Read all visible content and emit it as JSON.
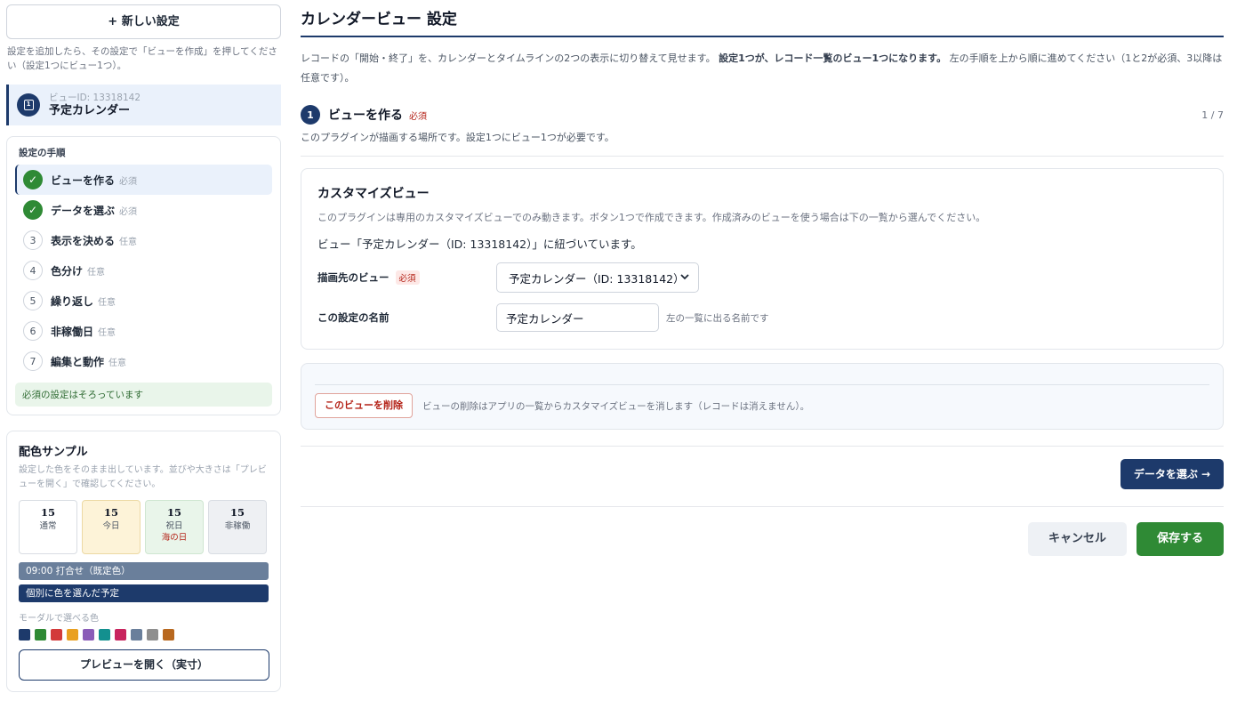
{
  "sidebar": {
    "new_button": "+ 新しい設定",
    "hint": "設定を追加したら、その設定で「ビューを作成」を押してください（設定1つにビュー1つ）。",
    "view": {
      "id_label": "ビューID: 13318142",
      "name": "予定カレンダー",
      "icon": "calendar-icon"
    },
    "steps_title": "設定の手順",
    "steps": [
      {
        "num": "✓",
        "label": "ビューを作る",
        "tag": "必須"
      },
      {
        "num": "✓",
        "label": "データを選ぶ",
        "tag": "必須"
      },
      {
        "num": "3",
        "label": "表示を決める",
        "tag": "任意"
      },
      {
        "num": "4",
        "label": "色分け",
        "tag": "任意"
      },
      {
        "num": "5",
        "label": "繰り返し",
        "tag": "任意"
      },
      {
        "num": "6",
        "label": "非稼働日",
        "tag": "任意"
      },
      {
        "num": "7",
        "label": "編集と動作",
        "tag": "任意"
      }
    ],
    "steps_status": "必須の設定はそろっています"
  },
  "sample": {
    "title": "配色サンプル",
    "hint": "設定した色をそのまま出しています。並びや大きさは「プレビューを開く」で確認してください。",
    "days": [
      {
        "num": "15",
        "label": "通常",
        "sub": ""
      },
      {
        "num": "15",
        "label": "今日",
        "sub": ""
      },
      {
        "num": "15",
        "label": "祝日",
        "sub": "海の日"
      },
      {
        "num": "15",
        "label": "非稼働",
        "sub": ""
      }
    ],
    "event_default": "09:00 打合せ（既定色）",
    "event_custom": "個別に色を選んだ予定",
    "palette_label": "モーダルで選べる色",
    "palette": [
      "#1d3a6b",
      "#2f8a35",
      "#d33a3a",
      "#e9a020",
      "#8a5cb8",
      "#13908f",
      "#c8245e",
      "#6a7f9b",
      "#8e8e8e",
      "#b8681f"
    ],
    "preview_button": "プレビューを開く（実寸）"
  },
  "main": {
    "title": "カレンダービュー 設定",
    "intro_1": "レコードの「開始・終了」を、カレンダーとタイムラインの2つの表示に切り替えて見せます。",
    "intro_bold": "設定1つが、レコード一覧のビュー1つになります。",
    "intro_2": "左の手順を上から順に進めてください（1と2が必須、3以降は任意です）。",
    "step": {
      "num": "1",
      "title": "ビューを作る",
      "req": "必須",
      "count": "1 / 7",
      "desc": "このプラグインが描画する場所です。設定1つにビュー1つが必要です。"
    },
    "card": {
      "title": "カスタマイズビュー",
      "desc": "このプラグインは専用のカスタマイズビューでのみ動きます。ボタン1つで作成できます。作成済みのビューを使う場合は下の一覧から選んでください。",
      "link_status": "ビュー「予定カレンダー（ID: 13318142）」に紐づいています。",
      "target_label": "描画先のビュー",
      "target_req": "必須",
      "target_value": "予定カレンダー（ID: 13318142）",
      "name_label": "この設定の名前",
      "name_value": "予定カレンダー",
      "name_hint": "左の一覧に出る名前です"
    },
    "danger": {
      "delete_button": "このビューを削除",
      "hint": "ビューの削除はアプリの一覧からカスタマイズビューを消します（レコードは消えません）。"
    },
    "next_button": "データを選ぶ →",
    "cancel_button": "キャンセル",
    "save_button": "保存する"
  },
  "colors": {
    "accent": "#1d3a6b",
    "success": "#2f8a35",
    "danger": "#b42318"
  }
}
